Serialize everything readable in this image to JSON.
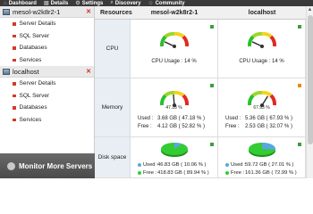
{
  "nav": {
    "items": [
      {
        "icon": "home-icon",
        "label": "Dashboard"
      },
      {
        "icon": "details-icon",
        "label": "Details"
      },
      {
        "icon": "settings-icon",
        "label": "Settings"
      },
      {
        "icon": "discovery-icon",
        "label": "Discovery"
      },
      {
        "icon": "community-icon",
        "label": "Community"
      }
    ]
  },
  "sidebar": {
    "hosts": [
      {
        "name": "mesol-w2k8r2-1",
        "items": [
          "Server Details",
          "SQL Server",
          "Databases",
          "Services"
        ]
      },
      {
        "name": "localhost",
        "items": [
          "Server Details",
          "SQL Server",
          "Databases",
          "Services"
        ]
      }
    ],
    "monitor_more": "Monitor More Servers"
  },
  "table": {
    "headers": [
      "Resources",
      "mesol-w2k8r2-1",
      "localhost"
    ],
    "cpu": {
      "label": "CPU",
      "host1": {
        "usage_text": "CPU Usage :  14  %",
        "value": 14
      },
      "host2": {
        "usage_text": "CPU Usage :  14  %",
        "value": 14
      }
    },
    "memory": {
      "label": "Memory",
      "host1": {
        "gauge_text": "47.18 %",
        "used_label": "Used :",
        "used": "3.68  GB ( 47.18 % )",
        "free_label": "Free :",
        "free": "4.12  GB ( 52.82 % )",
        "value": 47.18
      },
      "host2": {
        "gauge_text": "67.93 %",
        "used_label": "Used :",
        "used": "5.36  GB ( 67.93 % )",
        "free_label": "Free :",
        "free": "2.53  GB ( 32.07 % )",
        "value": 67.93
      }
    },
    "disk": {
      "label": "Disk space",
      "host1": {
        "used_label": "Used :",
        "used": "46.83  GB ( 10.06 % )",
        "free_label": "Free :",
        "free": "418.83  GB ( 89.94 % )",
        "used_pct": 10.06
      },
      "host2": {
        "used_label": "Used :",
        "used": "59.72  GB ( 27.01 % )",
        "free_label": "Free :",
        "free": "161.36  GB ( 72.99 % )",
        "used_pct": 27.01
      }
    }
  },
  "colors": {
    "ok": "#3aa03a",
    "warn": "#e88a1a",
    "disk_used": "#5aa6e0",
    "disk_free": "#33cc33"
  }
}
